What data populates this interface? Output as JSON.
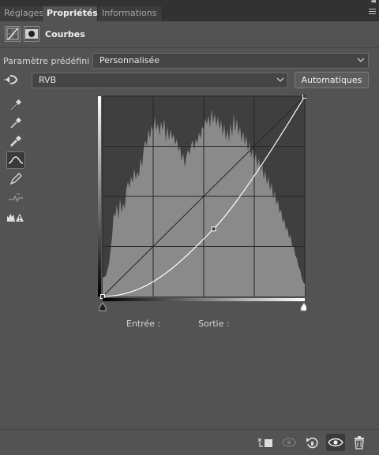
{
  "tabs": [
    {
      "label": "Réglages",
      "active": false
    },
    {
      "label": "Propriétés",
      "active": true
    },
    {
      "label": "Informations",
      "active": false
    }
  ],
  "header": {
    "title": "Courbes",
    "icons": [
      "curves-adjustment-icon",
      "layer-mask-icon"
    ]
  },
  "preset": {
    "label": "Paramètre prédéfini :",
    "value": "Personnalisée"
  },
  "channel": {
    "value": "RVB"
  },
  "auto_button": "Automatiques",
  "tools": [
    "target-adjust-icon",
    "sample-black-point-eyedropper-icon",
    "sample-gray-point-eyedropper-icon",
    "sample-white-point-eyedropper-icon",
    "curve-points-icon",
    "pencil-draw-icon",
    "smooth-curve-icon",
    "clipping-warning-icon"
  ],
  "curve": {
    "input_label": "Entrée :",
    "output_label": "Sortie :",
    "input_value": "",
    "output_value": "",
    "points": [
      [
        0,
        0
      ],
      [
        140,
        86
      ],
      [
        255,
        255
      ]
    ]
  },
  "footer": [
    "clip-to-layer-icon",
    "view-previous-state-icon",
    "reset-adjustments-icon",
    "toggle-visibility-icon",
    "delete-adjustment-icon"
  ],
  "colors": {
    "panel": "#535353",
    "tabbar": "#323232",
    "histogram": "#8a8a8a",
    "graph_bg": "#3f3f3f"
  }
}
